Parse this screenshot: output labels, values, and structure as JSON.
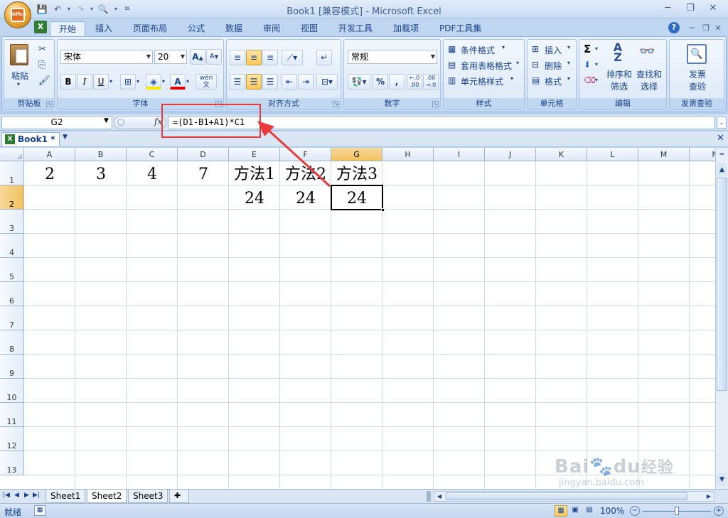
{
  "window": {
    "title": "Book1  [兼容模式] - Microsoft Excel",
    "office_logo": "Office"
  },
  "ribbon": {
    "tabs": [
      "开始",
      "插入",
      "页面布局",
      "公式",
      "数据",
      "审阅",
      "视图",
      "开发工具",
      "加载项",
      "PDF工具集"
    ],
    "active_tab": "开始",
    "clipboard": {
      "label": "剪贴板",
      "paste": "粘贴"
    },
    "font": {
      "label": "字体",
      "name": "宋体",
      "size": "20",
      "bold": "B",
      "italic": "I",
      "underline": "U",
      "pinyin": "wén"
    },
    "alignment": {
      "label": "对齐方式"
    },
    "number": {
      "label": "数字",
      "format": "常规",
      "percent": "%",
      "comma": ","
    },
    "styles": {
      "label": "样式",
      "conditional": "条件格式",
      "table": "套用表格格式",
      "cell": "单元格样式"
    },
    "cells": {
      "label": "单元格",
      "insert": "插入",
      "delete": "删除",
      "format": "格式"
    },
    "editing": {
      "label": "编辑",
      "sum": "Σ",
      "sort_l1": "排序和",
      "sort_l2": "筛选",
      "find_l1": "查找和",
      "find_l2": "选择"
    },
    "invoice": {
      "label": "发票查验",
      "btn_l1": "发票",
      "btn_l2": "查验"
    }
  },
  "formula_bar": {
    "name_box": "G2",
    "fx": "fx",
    "formula": "=(D1-B1+A1)*C1"
  },
  "workbook_tab": "Book1 *",
  "sheet": {
    "columns": [
      "A",
      "B",
      "C",
      "D",
      "E",
      "F",
      "G",
      "H",
      "I",
      "J",
      "K",
      "L",
      "M",
      "N"
    ],
    "rows": [
      "1",
      "2",
      "3",
      "4",
      "5",
      "6",
      "7",
      "8",
      "9",
      "10",
      "11",
      "12",
      "13"
    ],
    "selected_cell": "G2",
    "cells": {
      "A1": "2",
      "B1": "3",
      "C1": "4",
      "D1": "7",
      "E1": "方法1",
      "F1": "方法2",
      "G1": "方法3",
      "E2": "24",
      "F2": "24",
      "G2": "24"
    }
  },
  "sheet_tabs": [
    "Sheet1",
    "Sheet2",
    "Sheet3"
  ],
  "active_sheet": "Sheet2",
  "status_bar": {
    "ready": "就绪",
    "zoom": "100%"
  },
  "colors": {
    "annotation": "#e83a3a"
  },
  "watermark": "Baidu经验 jingyan.baidu.com"
}
